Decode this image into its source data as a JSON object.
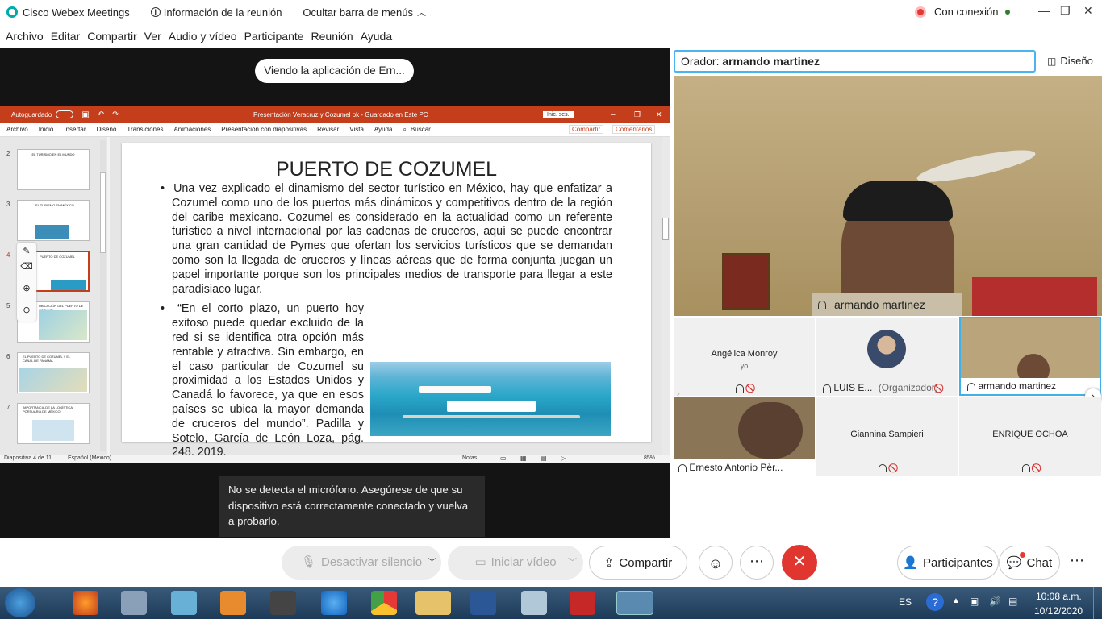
{
  "titlebar": {
    "app_name": "Cisco Webex Meetings",
    "meeting_info": "Información de la reunión",
    "hide_menu": "Ocultar barra de menús",
    "connection": "Con conexión"
  },
  "menu": [
    "Archivo",
    "Editar",
    "Compartir",
    "Ver",
    "Audio y vídeo",
    "Participante",
    "Reunión",
    "Ayuda"
  ],
  "share": {
    "viewing_label": "Viendo la aplicación de Ern...",
    "ppt": {
      "autosave": "Autoguardado",
      "file_title": "Presentación Veracruz y Cozumel ok - Guardado en Este PC",
      "signin": "Inic. ses.",
      "tabs": [
        "Archivo",
        "Inicio",
        "Insertar",
        "Diseño",
        "Transiciones",
        "Animaciones",
        "Presentación con diapositivas",
        "Revisar",
        "Vista",
        "Ayuda",
        "Buscar"
      ],
      "share_btn": "Compartir",
      "comments_btn": "Comentarios",
      "thumbnails": [
        "2",
        "3",
        "4",
        "5",
        "6",
        "7"
      ],
      "thumb_texts": [
        "EL TURISMO EN EL MUNDO",
        "EL TURISMO EN MÉXICO",
        "PUERTO DE COZUMEL",
        "UBICACIÓN DEL PUERTO DE COZUMEL",
        "EL PUERTO DE COZUMEL Y EL CANAL DE PANAMÁ",
        "IMPORTANCIA DE LA LOGÍSTICA PORTUARIA DE MÉXICO"
      ],
      "slide": {
        "title": "PUERTO DE COZUMEL",
        "bullet1": "Una vez explicado el dinamismo del sector turístico en México, hay que enfatizar a Cozumel como uno de los puertos más dinámicos y competitivos dentro de la región del caribe mexicano. Cozumel es considerado en la actualidad como un referente turístico a nivel internacional por las cadenas de cruceros, aquí se puede encontrar una gran cantidad de Pymes que ofertan los servicios turísticos que se demandan como son la llegada de cruceros y líneas aéreas que de forma conjunta juegan un papel importante porque son los principales medios de transporte para llegar a este paradisiaco lugar.",
        "bullet2": "“En el corto plazo, un puerto hoy exitoso puede quedar excluido de la red si se identifica otra opción más rentable y atractiva. Sin embargo, en el caso particular de Cozumel su proximidad a los Estados Unidos y Canadá lo favorece, ya que en esos países se ubica la mayor demanda de cruceros del mundo”. Padilla y Sotelo, García de León Loza, pág. 248, 2019."
      },
      "status_slide": "Diapositiva 4 de 11",
      "status_lang": "Español (México)",
      "status_notes": "Notas",
      "zoom": "85%"
    },
    "mic_warning": "No se detecta el micrófono. Asegúrese de que su dispositivo está correctamente conectado y vuelva a probarlo."
  },
  "panel": {
    "speaker_prefix": "Orador:",
    "speaker_name": "armando martinez",
    "layout": "Diseño",
    "main_video_name": "armando martinez",
    "participants": [
      {
        "name": "Angélica Monroy",
        "sub": "yo"
      },
      {
        "name": "LUIS E...",
        "role": "(Organizador)"
      },
      {
        "name": "armando martinez"
      },
      {
        "name": "Ernesto Antonio Pèr..."
      },
      {
        "name": "Giannina Sampieri"
      },
      {
        "name": "ENRIQUE OCHOA"
      }
    ]
  },
  "toolbar": {
    "mute": "Desactivar silencio",
    "video": "Iniciar vídeo",
    "share": "Compartir",
    "participants": "Participantes",
    "chat": "Chat"
  },
  "taskbar": {
    "lang": "ES",
    "time": "10:08 a.m.",
    "date": "10/12/2020"
  },
  "colors": {
    "ppt_red": "#c43e1c",
    "webex_blue": "#4ab3f0",
    "end_call_red": "#e0362f"
  }
}
